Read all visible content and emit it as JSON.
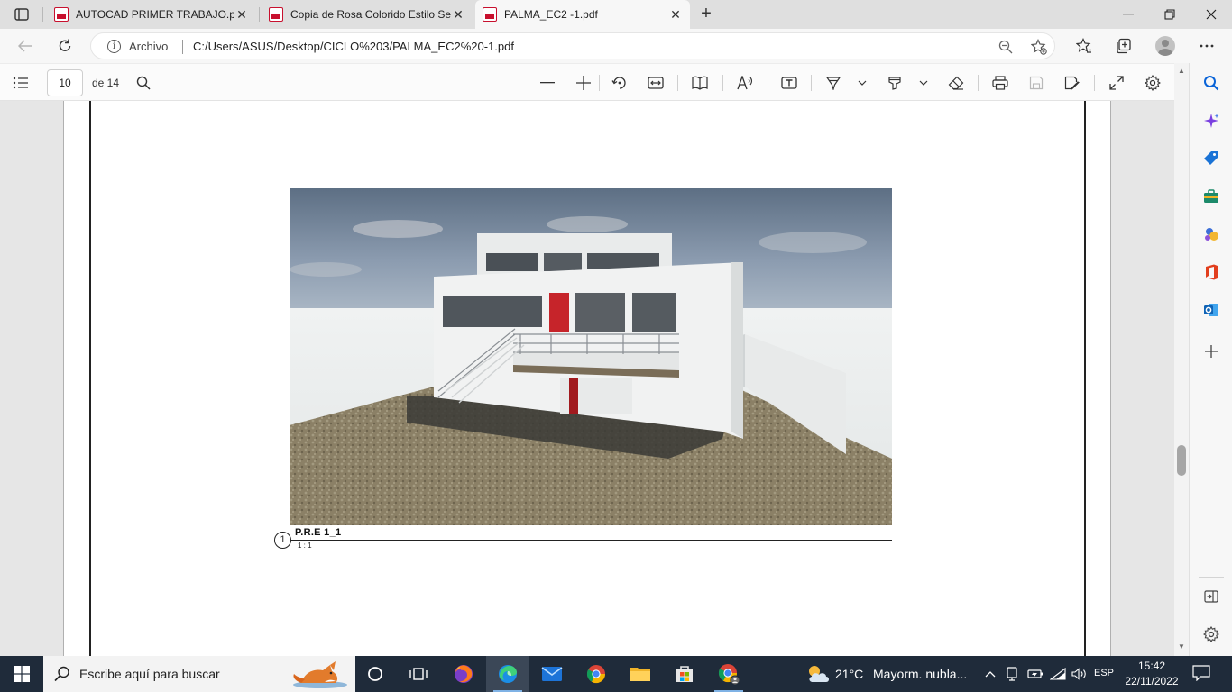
{
  "tabs": [
    {
      "label": "AUTOCAD PRIMER TRABAJO.pdf",
      "active": false
    },
    {
      "label": "Copia de Rosa Colorido Estilo Se",
      "active": false
    },
    {
      "label": "PALMA_EC2 -1.pdf",
      "active": true
    }
  ],
  "address": {
    "site_label": "Archivo",
    "url": "C:/Users/ASUS/Desktop/CICLO%203/PALMA_EC2%20-1.pdf"
  },
  "pdf_toolbar": {
    "current_page": "10",
    "total_pages": "de 14"
  },
  "document": {
    "caption_number": "1",
    "caption_title": "P.R.E 1_1",
    "caption_scale": "1 : 1"
  },
  "taskbar": {
    "search_placeholder": "Escribe aquí para buscar",
    "weather_temp": "21°C",
    "weather_desc": "Mayorm. nubla...",
    "language": "ESP",
    "time": "15:42",
    "date": "22/11/2022"
  },
  "colors": {
    "accent_blue": "#0a64d8",
    "taskbar_bg": "#1f2b3a",
    "pdf_red": "#c8102e"
  }
}
